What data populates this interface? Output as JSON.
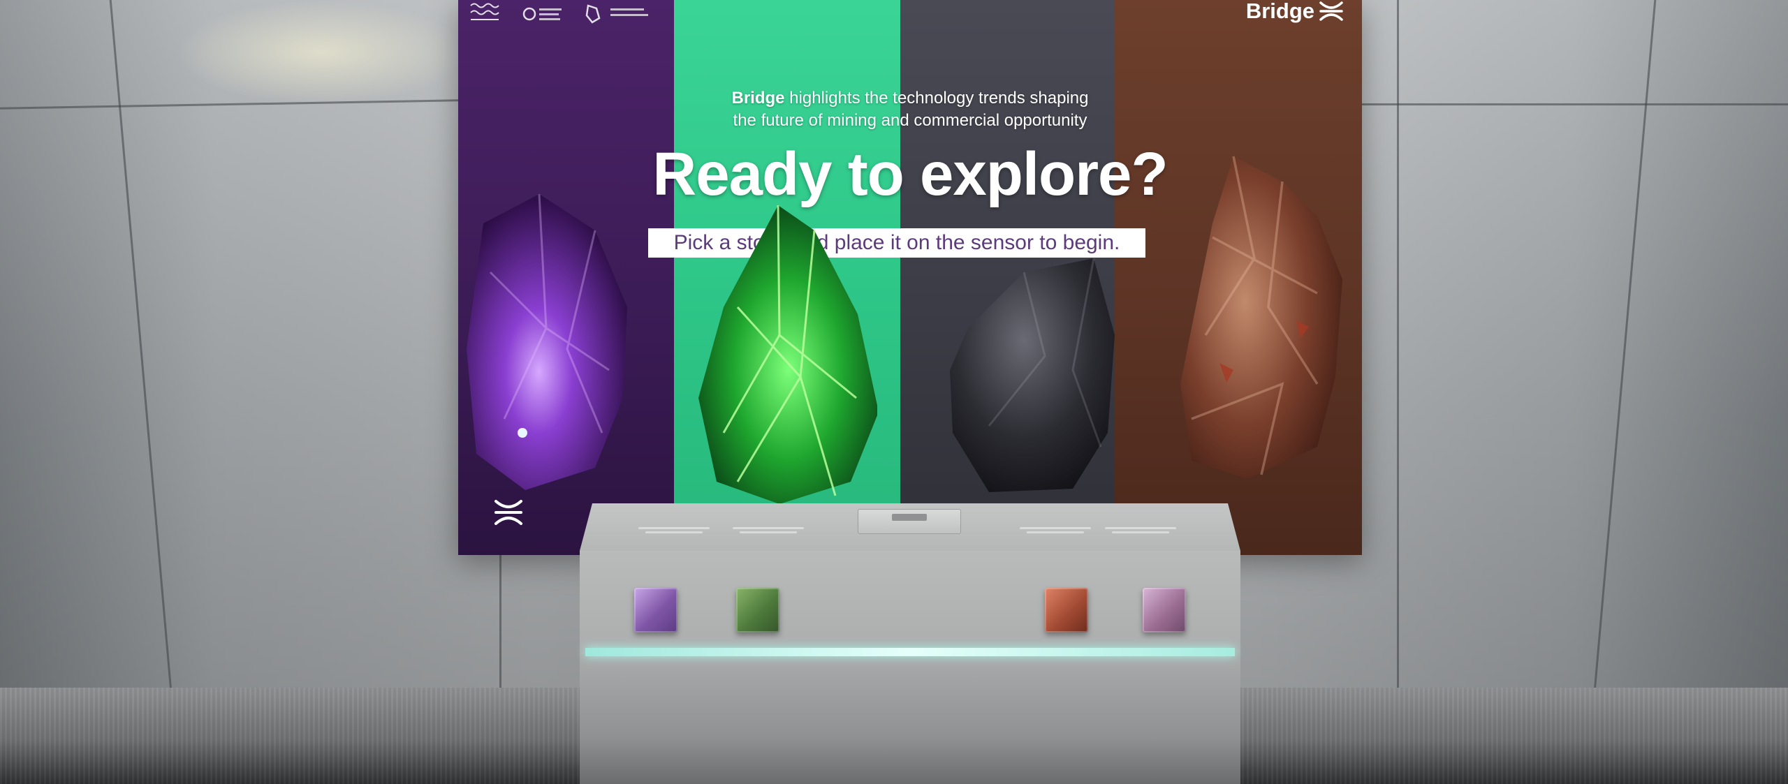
{
  "screen": {
    "brand_name": "Bridge",
    "tagline_brand": "Bridge",
    "tagline_line1_rest": " highlights the technology trends shaping",
    "tagline_line2": "the future of mining and commercial opportunity",
    "headline": "Ready to explore?",
    "instruction": "Pick a stone and place it on the sensor to begin.",
    "stripes": [
      "#3d1d57",
      "#31c98c",
      "#3e3e48",
      "#5e3526"
    ],
    "stones": [
      "amethyst-crystal",
      "glowing-green-crystal",
      "dark-rock",
      "brown-ore-rock"
    ]
  },
  "kiosk": {
    "cubes": [
      "amethyst-sample",
      "emerald-sample",
      "copper-sample",
      "quartz-sample"
    ],
    "accent_light": "#c8fff5"
  },
  "icons": [
    "bridge-logo-icon",
    "government-logo-icon",
    "ministry-logo-icon",
    "partner-logo-icon"
  ]
}
